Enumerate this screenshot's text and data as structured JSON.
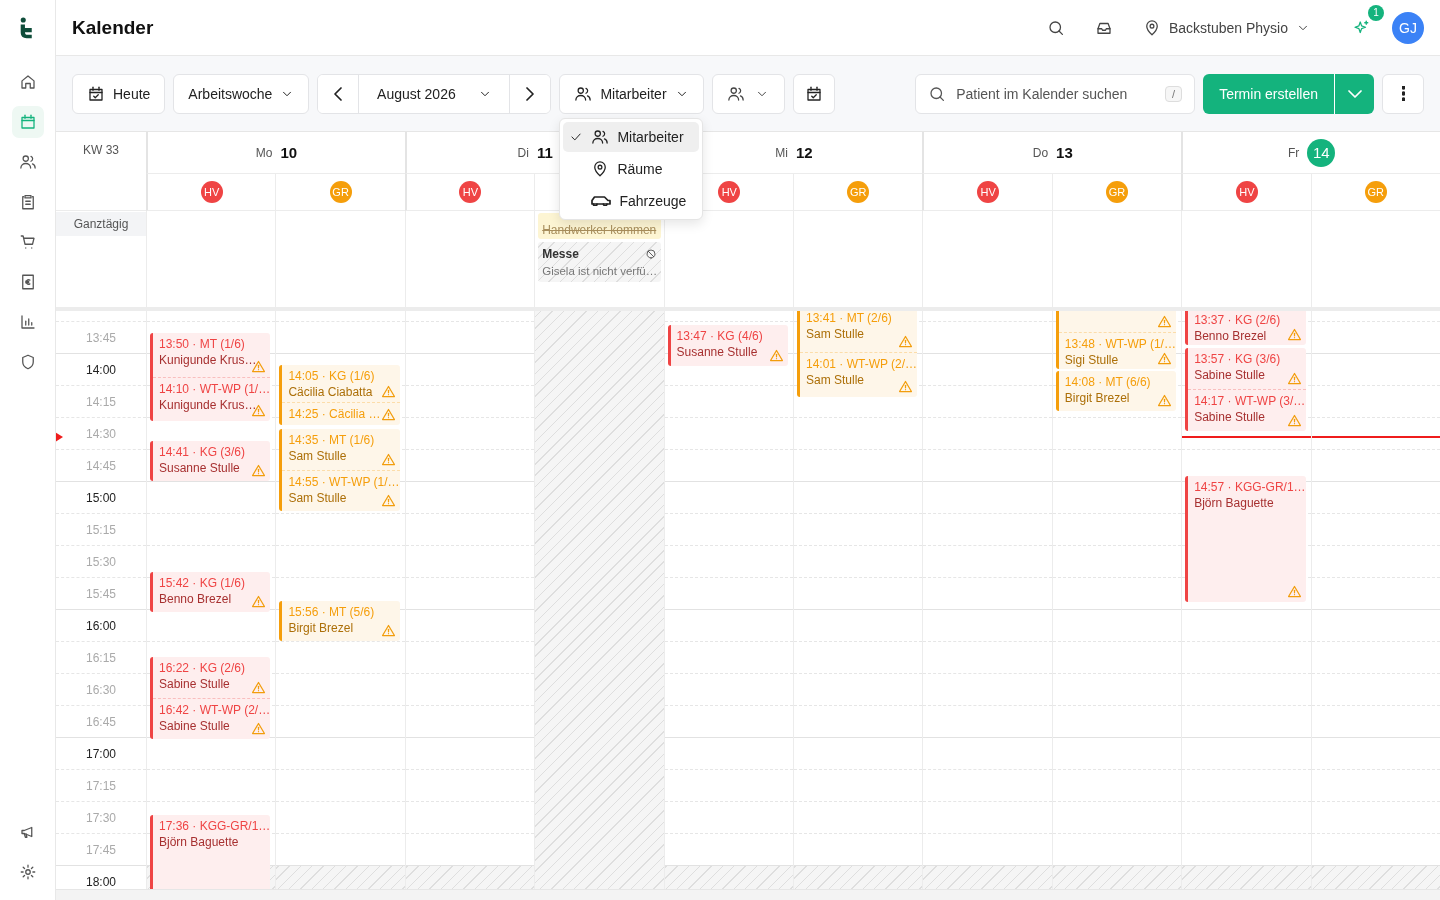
{
  "app": {
    "title": "Kalender"
  },
  "header": {
    "location": "Backstuben Physio",
    "notification_count": "1",
    "user_initials": "GJ"
  },
  "sidebar": {
    "items": [
      {
        "selected": false
      },
      {
        "selected": true
      },
      {
        "selected": false
      },
      {
        "selected": false
      },
      {
        "selected": false
      },
      {
        "selected": false
      },
      {
        "selected": false
      },
      {
        "selected": false
      }
    ],
    "bottom_items": [
      {
        "selected": false
      },
      {
        "selected": false
      }
    ]
  },
  "toolbar": {
    "today": "Heute",
    "range": "Arbeitswoche",
    "period": "August 2026",
    "resource": "Mitarbeiter",
    "search": {
      "placeholder": "Patient im Kalender suchen",
      "shortcut": "/"
    },
    "create": "Termin erstellen"
  },
  "resource_menu": [
    {
      "label": "Mitarbeiter",
      "selected": true
    },
    {
      "label": "Räume",
      "selected": false
    },
    {
      "label": "Fahrzeuge",
      "selected": false
    }
  ],
  "calendar": {
    "week": "KW 33",
    "all_day_label": "Ganztägig",
    "times": [
      {
        "label": "13:45",
        "hour": false,
        "closed": false
      },
      {
        "label": "14:00",
        "hour": true,
        "closed": false
      },
      {
        "label": "14:15",
        "hour": false,
        "closed": false
      },
      {
        "label": "14:30",
        "hour": false,
        "closed": false
      },
      {
        "label": "14:45",
        "hour": false,
        "closed": false
      },
      {
        "label": "15:00",
        "hour": true,
        "closed": false
      },
      {
        "label": "15:15",
        "hour": false,
        "closed": false
      },
      {
        "label": "15:30",
        "hour": false,
        "closed": false
      },
      {
        "label": "15:45",
        "hour": false,
        "closed": false
      },
      {
        "label": "16:00",
        "hour": true,
        "closed": false
      },
      {
        "label": "16:15",
        "hour": false,
        "closed": false
      },
      {
        "label": "16:30",
        "hour": false,
        "closed": false
      },
      {
        "label": "16:45",
        "hour": false,
        "closed": false
      },
      {
        "label": "17:00",
        "hour": true,
        "closed": false
      },
      {
        "label": "17:15",
        "hour": false,
        "closed": false
      },
      {
        "label": "17:30",
        "hour": false,
        "closed": false
      },
      {
        "label": "17:45",
        "hour": false,
        "closed": false
      },
      {
        "label": "18:00",
        "hour": true,
        "closed": true
      }
    ],
    "days": [
      {
        "weekday": "Mo",
        "date": "10",
        "today": false,
        "columns": [
          {
            "initials": "HV",
            "color": "#ef4444",
            "blocks": [
              {
                "appointments": [
                  {
                    "time": "13:50 · MT (1/6)",
                    "patient": "Kunigunde Krus…",
                    "warning": true
                  },
                  {
                    "time": "14:10 · WT-WP (1/…",
                    "patient": "Kunigunde Krus…",
                    "warning": true
                  }
                ]
              },
              {
                "appointments": [
                  {
                    "time": "14:41 · KG (3/6)",
                    "patient": "Susanne Stulle",
                    "warning": true
                  }
                ]
              },
              {
                "appointments": [
                  {
                    "time": "15:42 · KG (1/6)",
                    "patient": "Benno Brezel",
                    "warning": true
                  }
                ]
              },
              {
                "appointments": [
                  {
                    "time": "16:22 · KG (2/6)",
                    "patient": "Sabine Stulle",
                    "warning": true
                  },
                  {
                    "time": "16:42 · WT-WP (2/…",
                    "patient": "Sabine Stulle",
                    "warning": true
                  }
                ]
              },
              {
                "appointments": [
                  {
                    "time": "17:36 · KGG-GR/1…",
                    "patient": "Björn Baguette",
                    "warning": false
                  }
                ]
              }
            ]
          },
          {
            "initials": "GR",
            "color": "#f59e0b",
            "blocks": [
              {
                "appointments": [
                  {
                    "time": "14:05 · KG (1/6)",
                    "patient": "Cäcilia Ciabatta",
                    "warning": true
                  },
                  {
                    "time": "14:25 · Cäcilia …",
                    "warning": true
                  }
                ]
              },
              {
                "appointments": [
                  {
                    "time": "14:35 · MT (1/6)",
                    "patient": "Sam Stulle",
                    "warning": true
                  },
                  {
                    "time": "14:55 · WT-WP (1/…",
                    "patient": "Sam Stulle",
                    "warning": true
                  }
                ]
              },
              {
                "appointments": [
                  {
                    "time": "15:56 · MT (5/6)",
                    "patient": "Birgit Brezel",
                    "warning": true
                  }
                ]
              }
            ]
          }
        ]
      },
      {
        "weekday": "Di",
        "date": "11",
        "today": false,
        "columns": [
          {
            "initials": "HV",
            "color": "#ef4444"
          },
          {
            "unavailable": true,
            "all_day": [
              {
                "kind": "note",
                "title": "Handwerker kommen",
                "cancelled": true
              },
              {
                "kind": "absence",
                "title": "Messe",
                "detail": "Gisela ist nicht verfü…"
              }
            ]
          }
        ]
      },
      {
        "weekday": "Mi",
        "date": "12",
        "today": false,
        "columns": [
          {
            "initials": "HV",
            "color": "#ef4444",
            "blocks": [
              {
                "appointments": [
                  {
                    "time": "13:47 · KG (4/6)",
                    "patient": "Susanne Stulle",
                    "warning": true
                  }
                ]
              }
            ]
          },
          {
            "initials": "GR",
            "color": "#f59e0b",
            "blocks": [
              {
                "appointments": [
                  {
                    "time": "13:41 · MT (2/6)",
                    "patient": "Sam Stulle",
                    "warning": true
                  },
                  {
                    "time": "14:01 · WT-WP (2/…",
                    "patient": "Sam Stulle",
                    "warning": true
                  }
                ]
              }
            ]
          }
        ]
      },
      {
        "weekday": "Do",
        "date": "13",
        "today": false,
        "columns": [
          {
            "initials": "HV",
            "color": "#ef4444"
          },
          {
            "initials": "GR",
            "color": "#f59e0b",
            "blocks": [
              {
                "appointments": [
                  {
                    "warning": true
                  },
                  {
                    "time": "13:48 · WT-WP (1/…",
                    "patient": "Sigi Stulle",
                    "warning": true
                  }
                ]
              },
              {
                "appointments": [
                  {
                    "time": "14:08 · MT (6/6)",
                    "patient": "Birgit Brezel",
                    "warning": true
                  }
                ]
              }
            ]
          }
        ]
      },
      {
        "weekday": "Fr",
        "date": "14",
        "today": true,
        "columns": [
          {
            "initials": "HV",
            "color": "#ef4444",
            "blocks": [
              {
                "appointments": [
                  {
                    "time": "13:37 · KG (2/6)",
                    "patient": "Benno Brezel",
                    "warning": true
                  }
                ]
              },
              {
                "appointments": [
                  {
                    "time": "13:57 · KG (3/6)",
                    "patient": "Sabine Stulle",
                    "warning": true
                  },
                  {
                    "time": "14:17 · WT-WP (3/…",
                    "patient": "Sabine Stulle",
                    "warning": true
                  }
                ]
              },
              {
                "appointments": [
                  {
                    "time": "14:57 · KGG-GR/1…",
                    "patient": "Björn Baguette",
                    "warning": true
                  }
                ]
              }
            ]
          },
          {
            "initials": "GR",
            "color": "#f59e0b"
          }
        ]
      }
    ]
  }
}
